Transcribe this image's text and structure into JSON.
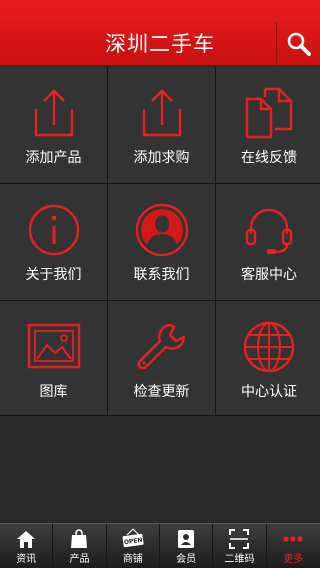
{
  "header": {
    "title": "深圳二手车"
  },
  "colors": {
    "accent": "#e52121",
    "tile": "#333333",
    "header": "#d81414"
  },
  "grid": [
    {
      "label": "添加产品",
      "icon": "share-upload-icon"
    },
    {
      "label": "添加求购",
      "icon": "share-upload-icon"
    },
    {
      "label": "在线反馈",
      "icon": "documents-icon"
    },
    {
      "label": "关于我们",
      "icon": "info-icon"
    },
    {
      "label": "联系我们",
      "icon": "person-icon"
    },
    {
      "label": "客服中心",
      "icon": "headset-icon"
    },
    {
      "label": "图库",
      "icon": "picture-icon"
    },
    {
      "label": "检查更新",
      "icon": "wrench-icon"
    },
    {
      "label": "中心认证",
      "icon": "globe-icon"
    }
  ],
  "tabs": [
    {
      "label": "资讯",
      "icon": "home-icon"
    },
    {
      "label": "产品",
      "icon": "bag-icon"
    },
    {
      "label": "商铺",
      "icon": "open-sign-icon",
      "badge": "OPEN"
    },
    {
      "label": "会员",
      "icon": "member-card-icon"
    },
    {
      "label": "二维码",
      "icon": "qr-scan-icon"
    },
    {
      "label": "更多",
      "icon": "more-dots-icon"
    }
  ]
}
